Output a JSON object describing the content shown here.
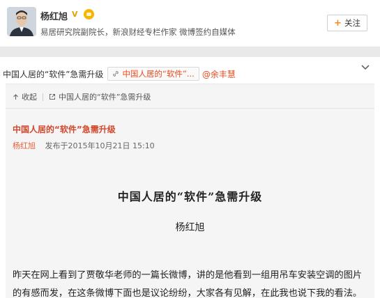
{
  "profile": {
    "name": "杨红旭",
    "verified_badge": "V",
    "description": "易居研究院副院长，新浪财经专栏作家 微博签约自媒体",
    "follow_label": "关注",
    "follow_plus": "+"
  },
  "post": {
    "text": "中国人居的“软件”急需升级",
    "link_chip_label": "中国人居的“软件”...",
    "mention": "@余丰慧"
  },
  "article_toolbar": {
    "collapse_label": "收起",
    "open_label": "中国人居的“软件”急需升级"
  },
  "article": {
    "title": "中国人居的“软件”急需升级",
    "author": "杨红旭",
    "published": "发布于2015年10月21日 15:10",
    "heading": "中国人居的“软件”急需升级",
    "byline": "杨红旭",
    "body": "昨天在网上看到了贾敬华老师的一篇长微博，讲的是他看到一组用吊车安装空调的图片的有感而发，在这条微博下面也是议论纷纷，大家各有见解，在此我也说下我的看法。"
  },
  "colors": {
    "accent_orange": "#e84a1f",
    "vip_gold": "#f7b500",
    "separator": "#e9e9e9"
  }
}
